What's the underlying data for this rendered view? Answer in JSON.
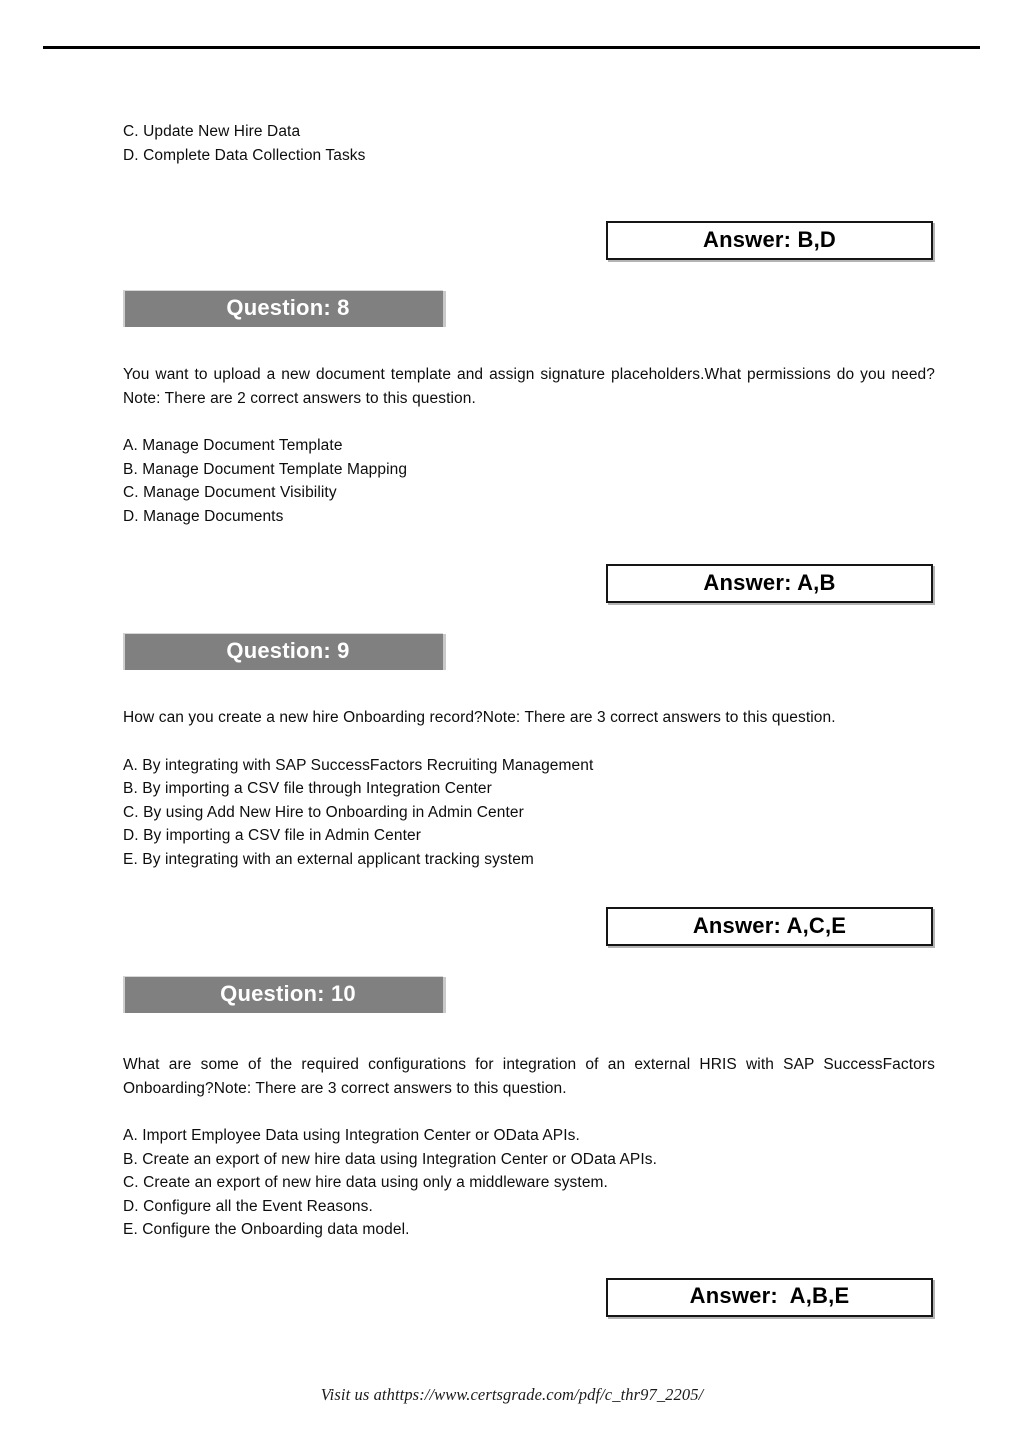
{
  "document": {
    "footer_text": "Visit us athttps://www.certsgrade.com/pdf/c_thr97_2205/"
  },
  "carryover_question": {
    "options": [
      "C. Update New Hire Data",
      "D. Complete Data Collection Tasks"
    ],
    "answer_label": "Answer: B,D"
  },
  "questions": [
    {
      "banner_label": "Question: 8",
      "stem": "You want to upload a new document template and assign signature placeholders.What permissions do you need?Note: There are 2 correct answers to this question.",
      "options": [
        "A. Manage Document Template",
        "B. Manage Document Template Mapping",
        "C. Manage Document Visibility",
        "D. Manage Documents"
      ],
      "answer_label": "Answer: A,B"
    },
    {
      "banner_label": "Question: 9",
      "stem": "How can you create a new hire Onboarding record?Note: There are 3 correct answers to this question.",
      "options": [
        "A. By integrating with SAP SuccessFactors Recruiting Management",
        "B. By importing a CSV file through Integration Center",
        "C. By using Add New Hire to Onboarding in Admin Center",
        "D. By importing a CSV file in Admin Center",
        "E. By integrating with an external applicant tracking system"
      ],
      "answer_label": "Answer: A,C,E"
    },
    {
      "banner_label": "Question: 10",
      "stem": "What are some of the required configurations for integration of an external HRIS with SAP SuccessFactors Onboarding?Note: There are 3 correct answers to this question.",
      "options": [
        "A. Import Employee Data using Integration Center or OData APIs.",
        "B. Create an export of new hire data using Integration Center or OData APIs.",
        "C. Create an export of new hire data using only a middleware system.",
        "D. Configure all the Event Reasons.",
        "E. Configure the Onboarding data model."
      ],
      "answer_label": "Answer:  A,B,E"
    }
  ],
  "colors": {
    "banner_fill": "#808080",
    "banner_text": "#ffffff",
    "rule": "#000000",
    "answer_border": "#151515"
  }
}
